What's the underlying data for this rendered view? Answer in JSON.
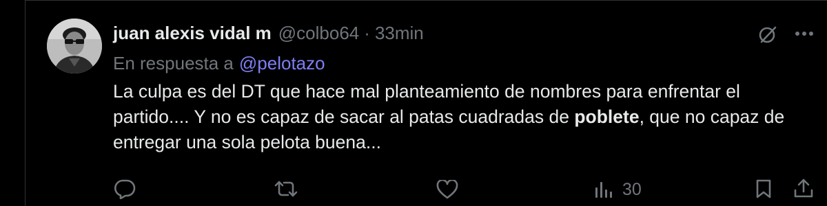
{
  "tweet": {
    "author": {
      "display_name": "juan alexis vidal m",
      "handle": "@colbo64",
      "separator": "·",
      "time_ago": "33min"
    },
    "reply": {
      "prefix": "En respuesta a",
      "mention": "@pelotazo"
    },
    "body": {
      "part1": "La culpa es del DT que hace mal planteamiento de nombres para enfrentar el partido.... Y no es capaz de sacar al patas cuadradas de ",
      "bold": "poblete",
      "part2": ", que no capaz de entregar una sola pelota buena..."
    },
    "stats": {
      "views": "30"
    }
  },
  "icons": {
    "grok": "grok-icon",
    "more": "more-icon",
    "reply": "reply-icon",
    "retweet": "retweet-icon",
    "like": "like-icon",
    "views": "views-icon",
    "bookmark": "bookmark-icon",
    "share": "share-icon"
  },
  "colors": {
    "background": "#000000",
    "text": "#e7e9ea",
    "secondary": "#71767b",
    "mention": "#7e7ef5",
    "border": "#2f3336"
  }
}
